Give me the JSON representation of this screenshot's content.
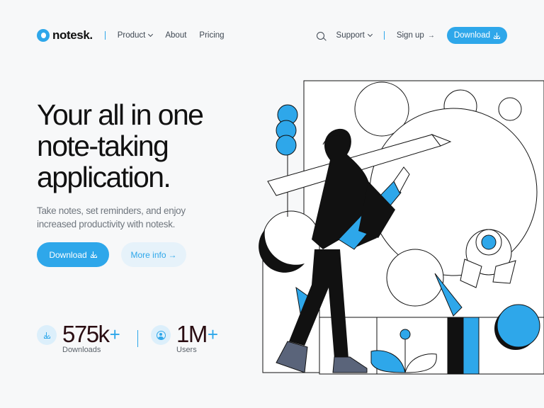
{
  "nav": {
    "brand": "notesk.",
    "links": [
      "Product",
      "About",
      "Pricing"
    ],
    "support": "Support",
    "signup": "Sign up",
    "signup_arrow": "→",
    "download": "Download"
  },
  "hero": {
    "title": "Your all in one note-taking application.",
    "subtitle": "Take notes, set reminders, and enjoy increased productivity with notesk.",
    "primary_cta": "Download",
    "secondary_cta": "More info",
    "secondary_arrow": "→"
  },
  "stats": [
    {
      "value": "575k",
      "suffix": "+",
      "label": "Downloads",
      "icon": "download-icon"
    },
    {
      "value": "1M",
      "suffix": "+",
      "label": "Users",
      "icon": "user-icon"
    }
  ],
  "colors": {
    "accent": "#2ea7ea",
    "background": "#f7f8f9",
    "text": "#111111",
    "muted": "#70777f",
    "figure_pants": "#000000",
    "shoes": "#5a647a"
  }
}
